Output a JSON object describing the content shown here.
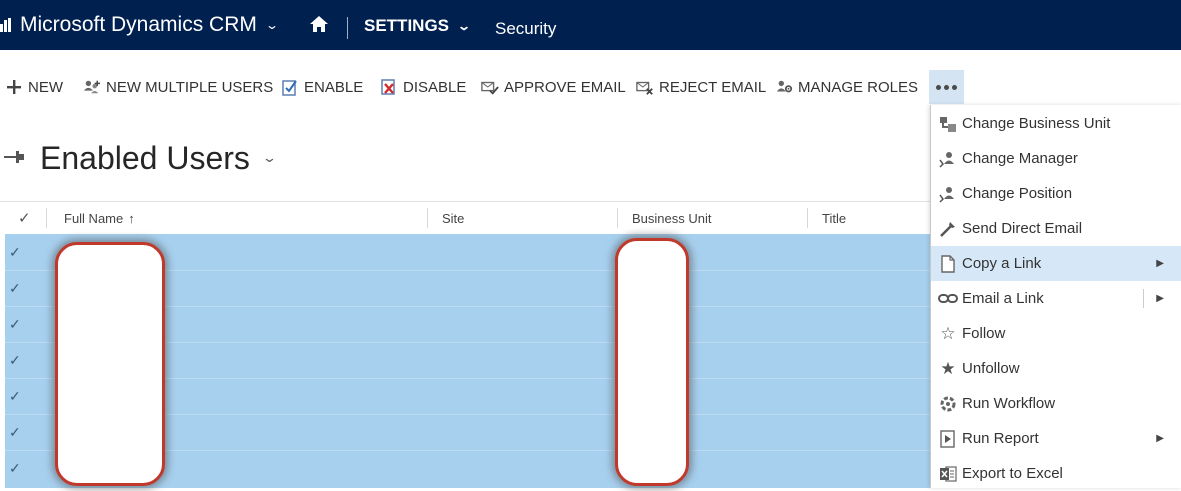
{
  "topnav": {
    "brand": "Microsoft Dynamics CRM",
    "area": "SETTINGS",
    "page": "Security"
  },
  "commands": [
    {
      "label": "NEW",
      "icon": "plus-icon"
    },
    {
      "label": "NEW MULTIPLE USERS",
      "icon": "multiple-users-icon"
    },
    {
      "label": "ENABLE",
      "icon": "enable-icon"
    },
    {
      "label": "DISABLE",
      "icon": "disable-icon"
    },
    {
      "label": "APPROVE EMAIL",
      "icon": "approve-email-icon"
    },
    {
      "label": "REJECT EMAIL",
      "icon": "reject-email-icon"
    },
    {
      "label": "MANAGE ROLES",
      "icon": "manage-roles-icon"
    }
  ],
  "view": {
    "title": "Enabled Users"
  },
  "grid": {
    "columns": [
      "Full Name",
      "Site",
      "Business Unit",
      "Title"
    ],
    "sort_indicator": "↑",
    "row_count": 7
  },
  "menu": {
    "items": [
      {
        "label": "Change Business Unit",
        "icon": "business-unit-icon"
      },
      {
        "label": "Change Manager",
        "icon": "manager-icon"
      },
      {
        "label": "Change Position",
        "icon": "position-icon"
      },
      {
        "label": "Send Direct Email",
        "icon": "direct-email-icon"
      },
      {
        "label": "Copy a Link",
        "icon": "copy-link-icon",
        "submenu": true,
        "highlighted": true
      },
      {
        "label": "Email a Link",
        "icon": "email-link-icon",
        "submenu": true
      },
      {
        "label": "Follow",
        "icon": "star-outline-icon"
      },
      {
        "label": "Unfollow",
        "icon": "star-filled-icon"
      },
      {
        "label": "Run Workflow",
        "icon": "workflow-icon"
      },
      {
        "label": "Run Report",
        "icon": "report-icon",
        "submenu": true
      },
      {
        "label": "Export to Excel",
        "icon": "excel-icon"
      }
    ]
  },
  "colors": {
    "nav_bg": "#002050",
    "selected_row": "#a7d0ef",
    "menu_highlight": "#d6e8f7",
    "redaction_border": "#c0392b"
  }
}
